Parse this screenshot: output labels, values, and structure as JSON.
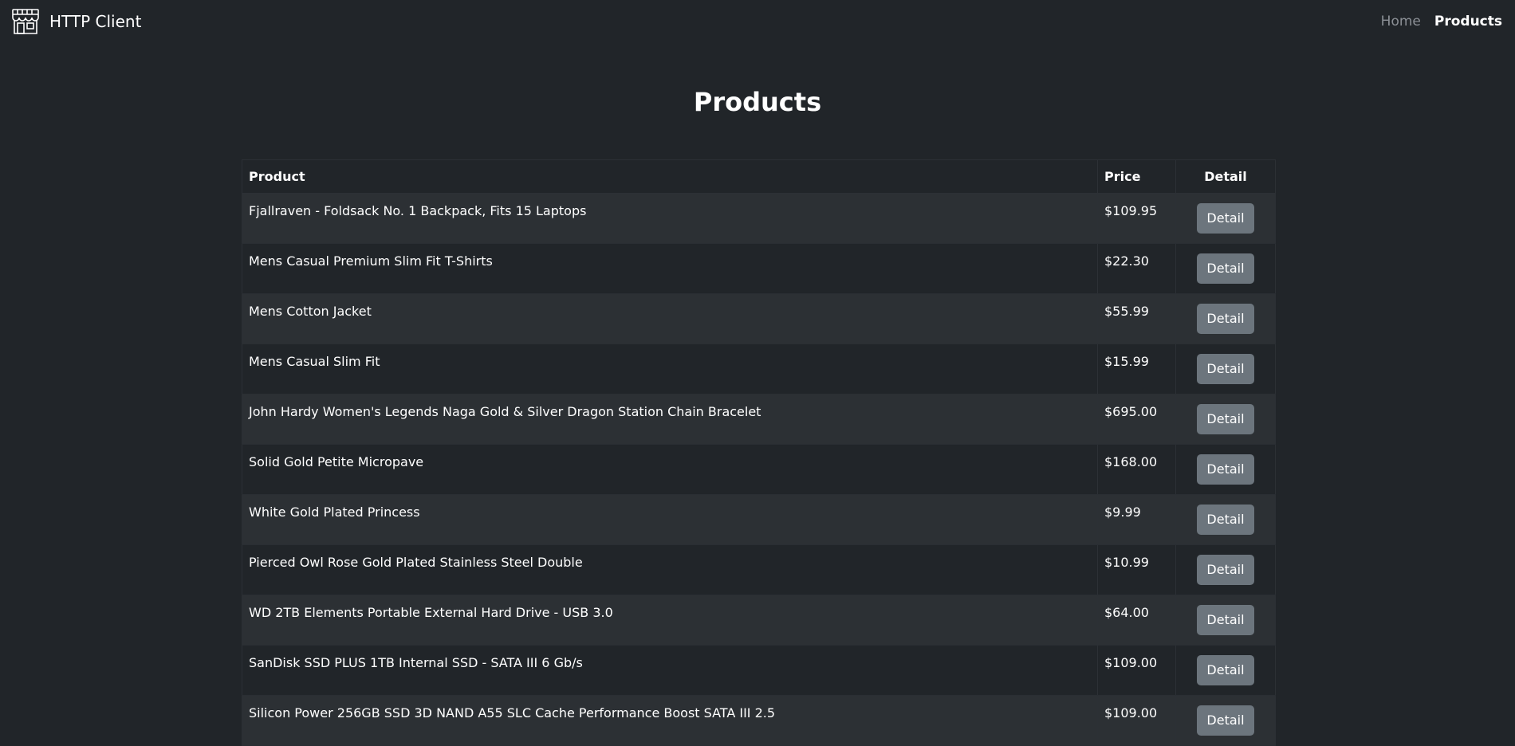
{
  "navbar": {
    "brand_icon": "storefront-icon",
    "brand_text": "HTTP Client",
    "links": [
      {
        "label": "Home",
        "active": false
      },
      {
        "label": "Products",
        "active": true
      }
    ]
  },
  "page": {
    "title": "Products"
  },
  "table": {
    "headers": {
      "product": "Product",
      "price": "Price",
      "detail": "Detail"
    },
    "detail_button_label": "Detail",
    "rows": [
      {
        "product": "Fjallraven - Foldsack No. 1 Backpack, Fits 15 Laptops",
        "price": "$109.95",
        "highlight": false
      },
      {
        "product": "Mens Casual Premium Slim Fit T-Shirts",
        "price": "$22.30",
        "highlight": false
      },
      {
        "product": "Mens Cotton Jacket",
        "price": "$55.99",
        "highlight": false
      },
      {
        "product": "Mens Casual Slim Fit",
        "price": "$15.99",
        "highlight": false
      },
      {
        "product": "John Hardy Women's Legends Naga Gold & Silver Dragon Station Chain Bracelet",
        "price": "$695.00",
        "highlight": true
      },
      {
        "product": "Solid Gold Petite Micropave",
        "price": "$168.00",
        "highlight": false
      },
      {
        "product": "White Gold Plated Princess",
        "price": "$9.99",
        "highlight": false
      },
      {
        "product": "Pierced Owl Rose Gold Plated Stainless Steel Double",
        "price": "$10.99",
        "highlight": false
      },
      {
        "product": "WD 2TB Elements Portable External Hard Drive - USB 3.0",
        "price": "$64.00",
        "highlight": false
      },
      {
        "product": "SanDisk SSD PLUS 1TB Internal SSD - SATA III 6 Gb/s",
        "price": "$109.00",
        "highlight": false
      },
      {
        "product": "Silicon Power 256GB SSD 3D NAND A55 SLC Cache Performance Boost SATA III 2.5",
        "price": "$109.00",
        "highlight": false
      }
    ]
  },
  "colors": {
    "background": "#212529",
    "stripe": "#2c3034",
    "button": "#6c757d",
    "highlight_price": "#2f7d32"
  }
}
